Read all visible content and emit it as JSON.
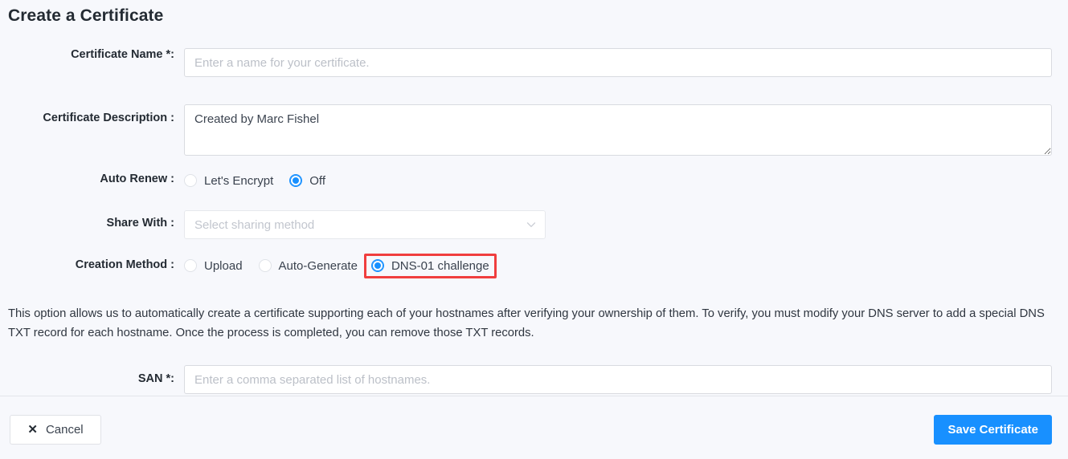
{
  "page": {
    "title": "Create a Certificate"
  },
  "form": {
    "certificate_name": {
      "label": "Certificate Name *:",
      "placeholder": "Enter a name for your certificate.",
      "value": ""
    },
    "certificate_description": {
      "label": "Certificate Description :",
      "placeholder": "",
      "value": "Created by Marc Fishel"
    },
    "auto_renew": {
      "label": "Auto Renew :",
      "options": [
        {
          "label": "Let's Encrypt",
          "checked": false
        },
        {
          "label": "Off",
          "checked": true
        }
      ]
    },
    "share_with": {
      "label": "Share With :",
      "placeholder": "Select sharing method",
      "value": "",
      "chevron_icon": "chevron-down-icon"
    },
    "creation_method": {
      "label": "Creation Method :",
      "options": [
        {
          "label": "Upload",
          "checked": false,
          "highlighted": false
        },
        {
          "label": "Auto-Generate",
          "checked": false,
          "highlighted": false
        },
        {
          "label": "DNS-01 challenge",
          "checked": true,
          "highlighted": true
        }
      ],
      "highlight_color": "#f03e3e"
    },
    "info_text": "This option allows us to automatically create a certificate supporting each of your hostnames after verifying your ownership of them. To verify, you must modify your DNS server to add a special DNS TXT record for each hostname. Once the process is completed, you can remove those TXT records.",
    "san": {
      "label": "SAN *:",
      "placeholder": "Enter a comma separated list of hostnames.",
      "value": ""
    }
  },
  "footer": {
    "cancel_label": "Cancel",
    "cancel_icon": "close-icon",
    "cancel_glyph": "✕",
    "save_label": "Save Certificate",
    "save_color": "#1890ff"
  }
}
